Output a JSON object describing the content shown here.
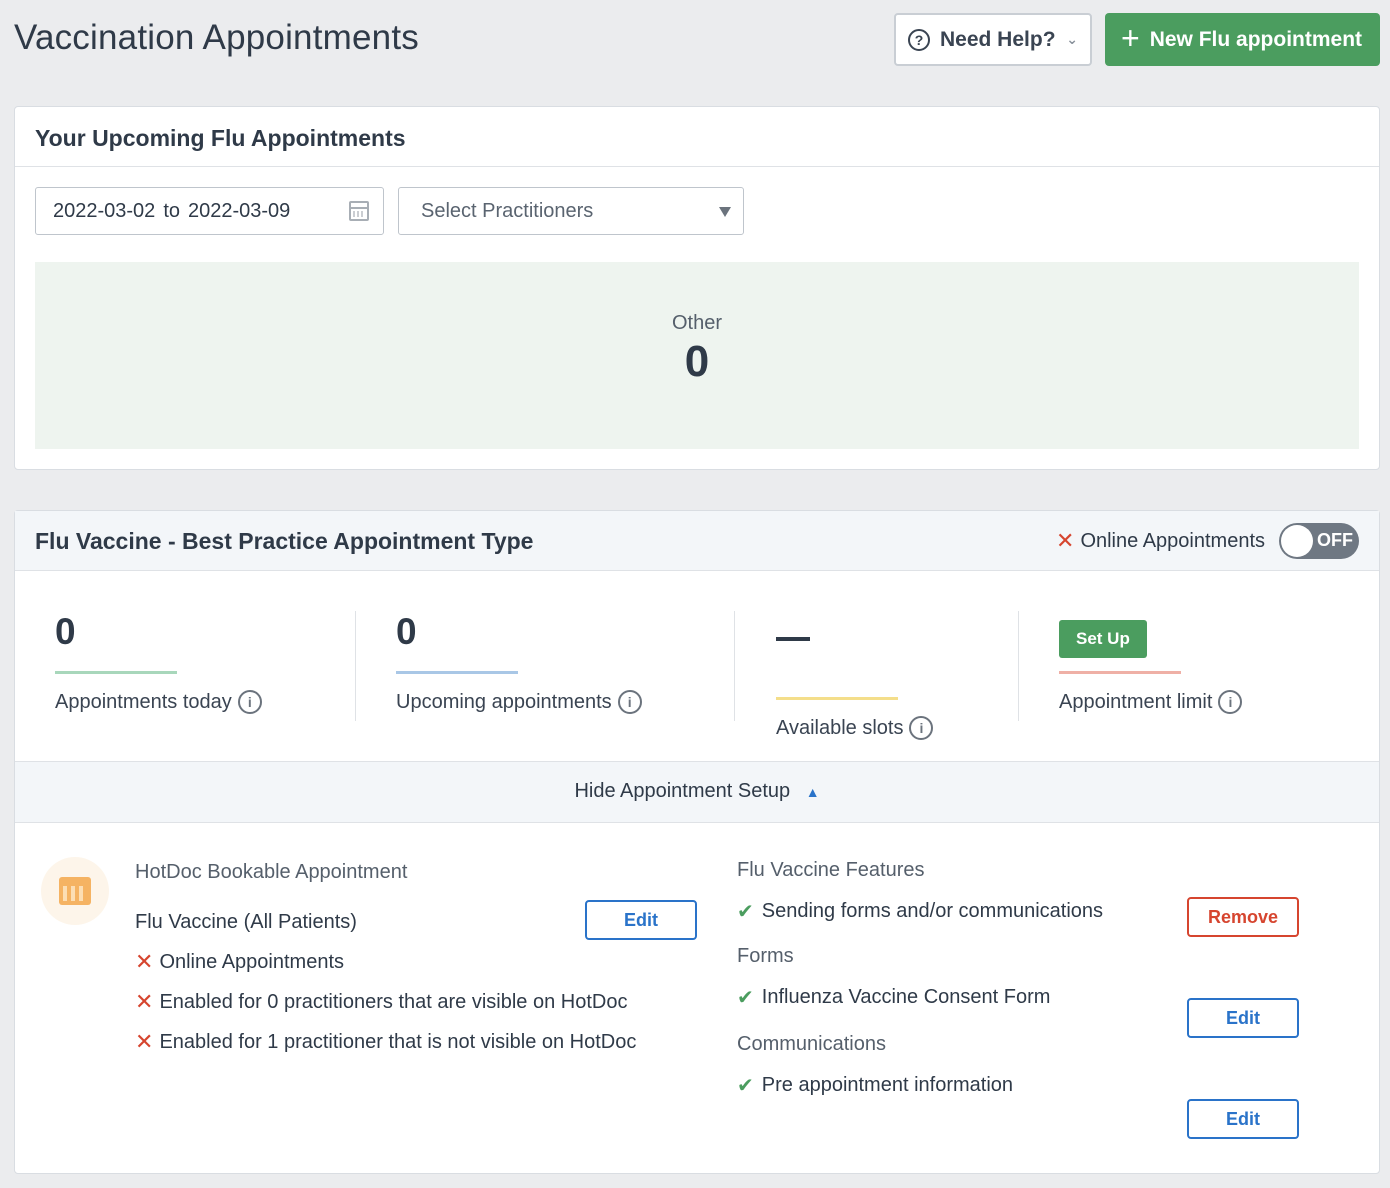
{
  "header": {
    "title": "Vaccination Appointments",
    "help_label": "Need Help?",
    "new_button_label": "New Flu appointment"
  },
  "upcoming": {
    "title": "Your Upcoming Flu Appointments",
    "date_from": "2022-03-02",
    "date_sep": "to",
    "date_to": "2022-03-09",
    "practitioners_placeholder": "Select Practitioners",
    "stat_label": "Other",
    "stat_value": "0"
  },
  "appointment_type": {
    "title": "Flu Vaccine - Best Practice Appointment Type",
    "online_label": "Online Appointments",
    "toggle_state": "OFF",
    "metrics": [
      {
        "value": "0",
        "label": "Appointments today",
        "color": "#a8d7bb"
      },
      {
        "value": "0",
        "label": "Upcoming appointments",
        "color": "#a9c7e6"
      },
      {
        "value": "—",
        "label": "Available slots",
        "color": "#f4de8a"
      },
      {
        "value": "Set Up",
        "label": "Appointment limit",
        "color": "#efb0a6"
      }
    ],
    "hide_setup_label": "Hide Appointment Setup",
    "bookable": {
      "title": "HotDoc Bookable Appointment",
      "name": "Flu Vaccine (All Patients)",
      "edit_label": "Edit",
      "items": [
        "Online Appointments",
        "Enabled for 0 practitioners that are visible on HotDoc",
        "Enabled for 1 practitioner that is not visible on HotDoc"
      ]
    },
    "features": {
      "title": "Flu Vaccine Features",
      "item": "Sending forms and/or communications",
      "remove_label": "Remove"
    },
    "forms": {
      "title": "Forms",
      "item": "Influenza Vaccine Consent Form",
      "edit_label": "Edit"
    },
    "communications": {
      "title": "Communications",
      "item": "Pre appointment information",
      "edit_label": "Edit"
    }
  }
}
